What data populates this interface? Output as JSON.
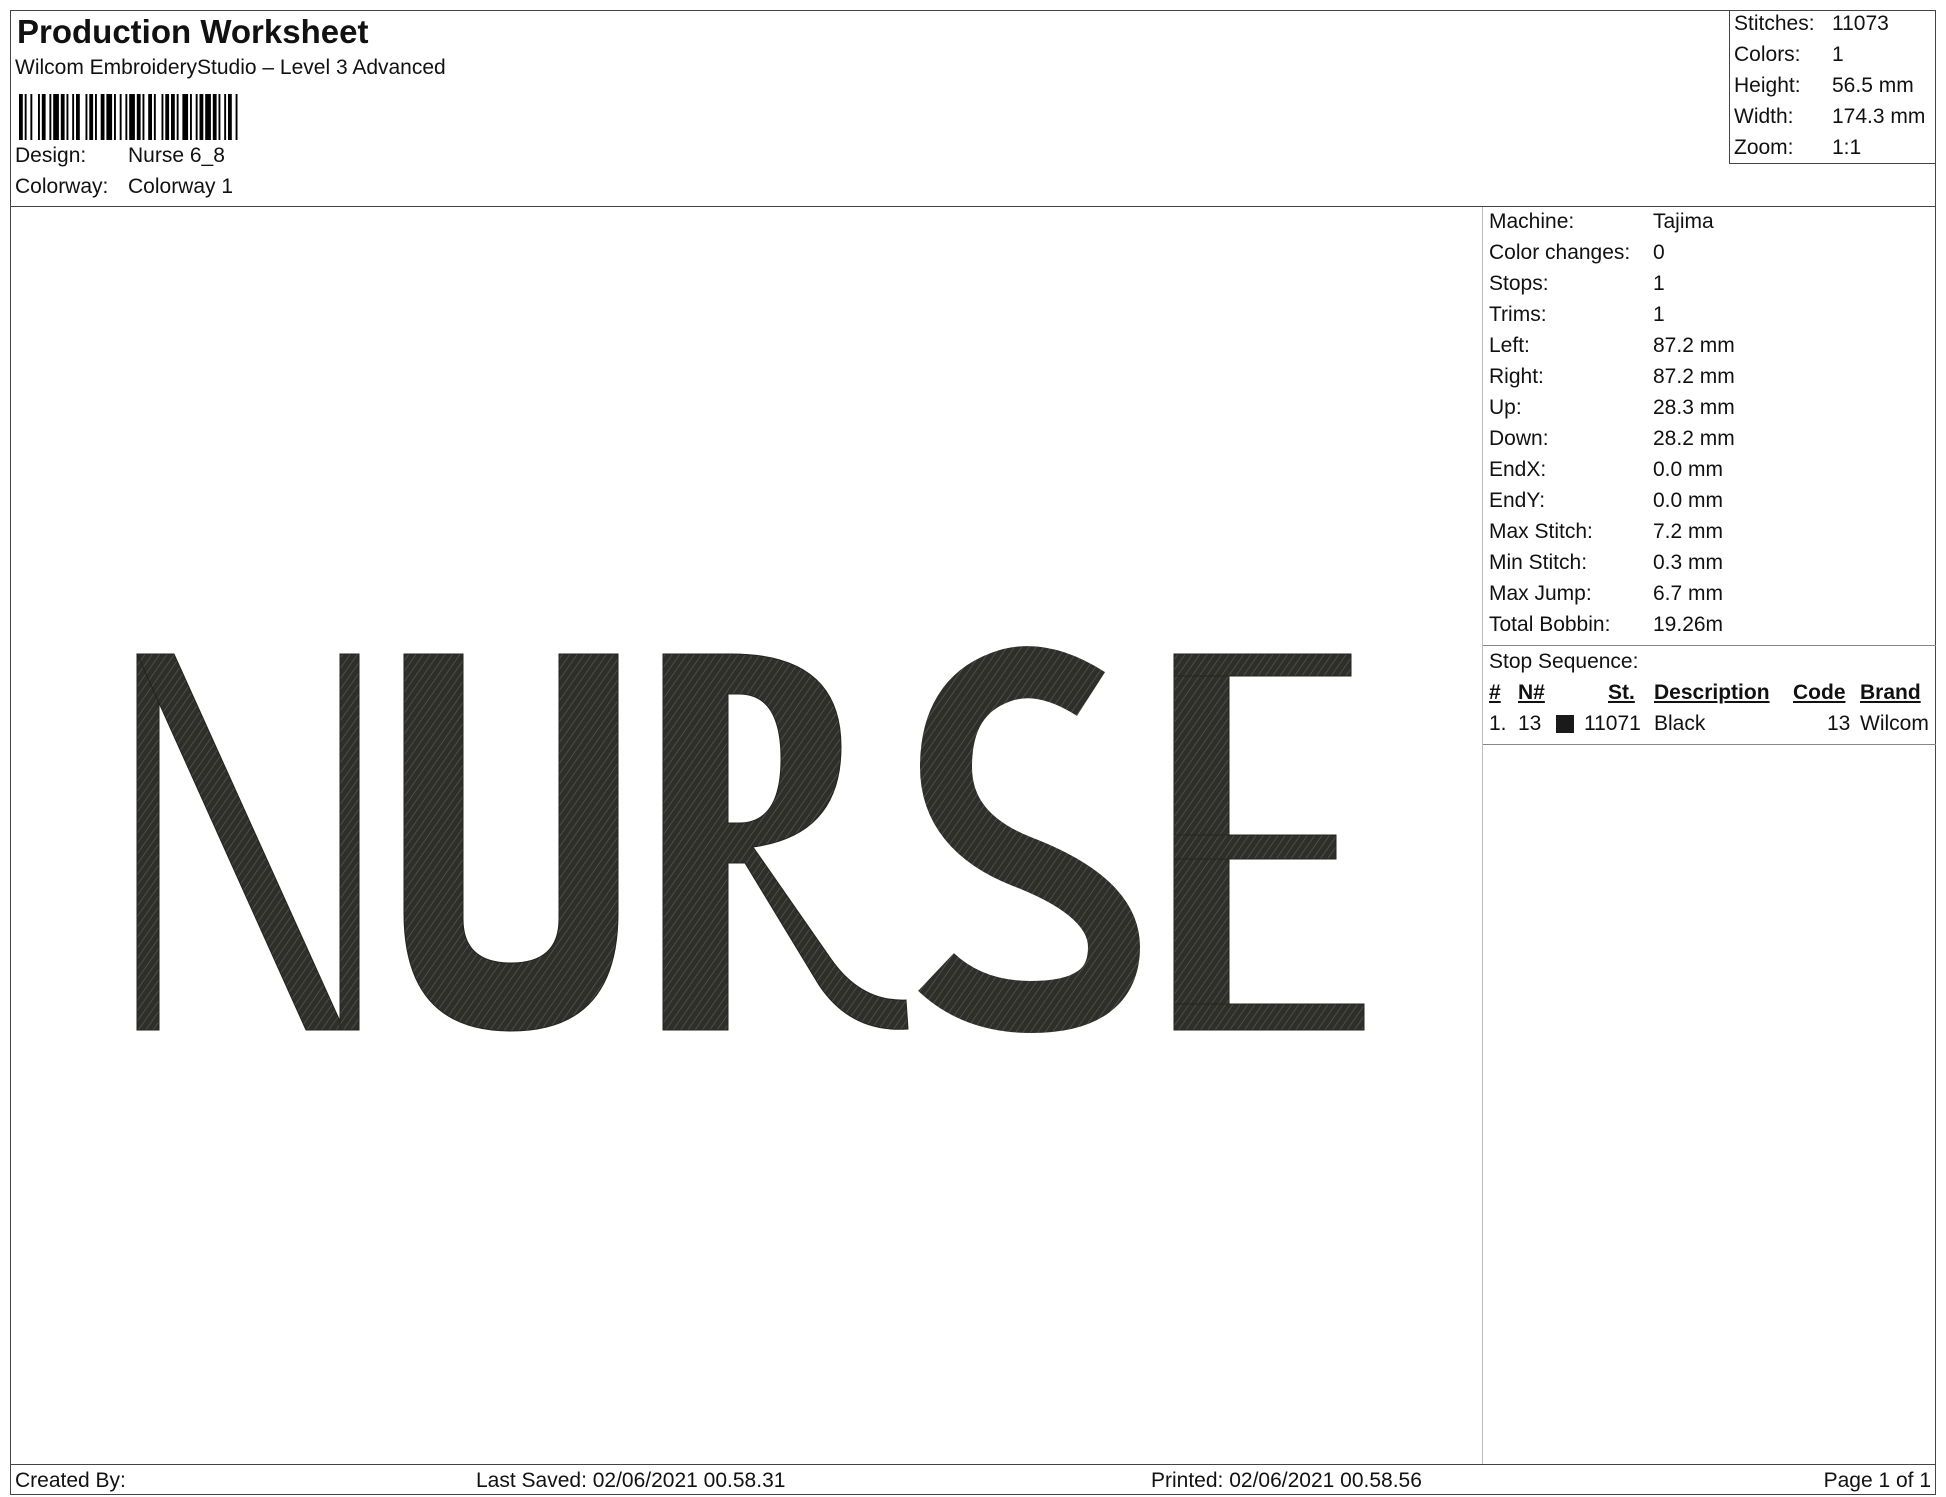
{
  "header": {
    "title": "Production Worksheet",
    "subtitle": "Wilcom EmbroideryStudio – Level 3 Advanced",
    "design_label": "Design:",
    "design_value": "Nurse 6_8",
    "colorway_label": "Colorway:",
    "colorway_value": "Colorway 1"
  },
  "summary": [
    {
      "label": "Stitches:",
      "value": "11073"
    },
    {
      "label": "Colors:",
      "value": "1"
    },
    {
      "label": "Height:",
      "value": "56.5 mm"
    },
    {
      "label": "Width:",
      "value": "174.3 mm"
    },
    {
      "label": "Zoom:",
      "value": "1:1"
    }
  ],
  "design_text": "NURSE",
  "thread_color": "#2e2f2a",
  "details": [
    {
      "label": "Machine:",
      "value": "Tajima"
    },
    {
      "label": "Color changes:",
      "value": "0"
    },
    {
      "label": "Stops:",
      "value": "1"
    },
    {
      "label": "Trims:",
      "value": "1"
    },
    {
      "label": "Left:",
      "value": "87.2 mm"
    },
    {
      "label": "Right:",
      "value": "87.2 mm"
    },
    {
      "label": "Up:",
      "value": "28.3 mm"
    },
    {
      "label": "Down:",
      "value": "28.2 mm"
    },
    {
      "label": "EndX:",
      "value": "0.0 mm"
    },
    {
      "label": "EndY:",
      "value": "0.0 mm"
    },
    {
      "label": "Max Stitch:",
      "value": "7.2 mm"
    },
    {
      "label": "Min Stitch:",
      "value": "0.3 mm"
    },
    {
      "label": "Max Jump:",
      "value": "6.7 mm"
    },
    {
      "label": "Total Bobbin:",
      "value": "19.26m"
    }
  ],
  "stop_sequence": {
    "title": "Stop Sequence:",
    "columns": {
      "num": "#",
      "n": "N#",
      "st": "St.",
      "description": "Description",
      "code": "Code",
      "brand": "Brand"
    },
    "rows": [
      {
        "num": "1.",
        "n": "13",
        "st": "11071",
        "description": "Black",
        "code": "13",
        "brand": "Wilcom",
        "color": "#1a1a1a"
      }
    ]
  },
  "footer": {
    "created_by": "Created By:",
    "last_saved": "Last Saved: 02/06/2021 00.58.31",
    "printed": "Printed: 02/06/2021 00.58.56",
    "page": "Page 1 of 1"
  }
}
